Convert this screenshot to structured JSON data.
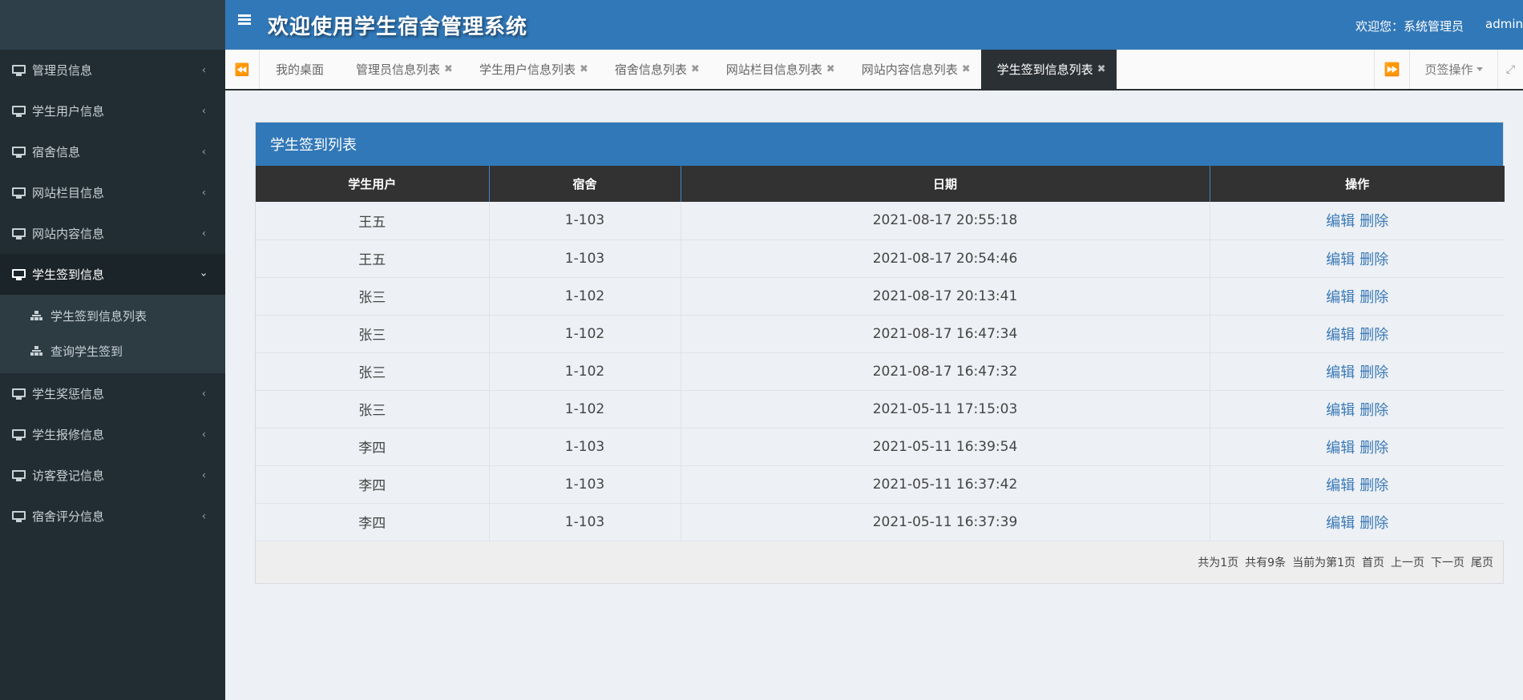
{
  "header": {
    "title": "欢迎使用学生宿舍管理系统",
    "welcome": "欢迎您：系统管理员",
    "user": "admin"
  },
  "sidebar": {
    "items": [
      {
        "label": "管理员信息"
      },
      {
        "label": "学生用户信息"
      },
      {
        "label": "宿舍信息"
      },
      {
        "label": "网站栏目信息"
      },
      {
        "label": "网站内容信息"
      },
      {
        "label": "学生签到信息"
      },
      {
        "label": "学生奖惩信息"
      },
      {
        "label": "学生报修信息"
      },
      {
        "label": "访客登记信息"
      },
      {
        "label": "宿舍评分信息"
      }
    ],
    "sub_items": [
      {
        "label": "学生签到信息列表"
      },
      {
        "label": "查询学生签到"
      }
    ]
  },
  "tabs": {
    "items": [
      {
        "label": "我的桌面"
      },
      {
        "label": "管理员信息列表"
      },
      {
        "label": "学生用户信息列表"
      },
      {
        "label": "宿舍信息列表"
      },
      {
        "label": "网站栏目信息列表"
      },
      {
        "label": "网站内容信息列表"
      },
      {
        "label": "学生签到信息列表"
      }
    ],
    "close_glyph": "✖",
    "page_ops": "页签操作"
  },
  "panel": {
    "title": "学生签到列表",
    "columns": [
      "学生用户",
      "宿舍",
      "日期",
      "操作"
    ],
    "rows": [
      {
        "user": "王五",
        "dorm": "1-103",
        "date": "2021-08-17 20:55:18"
      },
      {
        "user": "王五",
        "dorm": "1-103",
        "date": "2021-08-17 20:54:46"
      },
      {
        "user": "张三",
        "dorm": "1-102",
        "date": "2021-08-17 20:13:41"
      },
      {
        "user": "张三",
        "dorm": "1-102",
        "date": "2021-08-17 16:47:34"
      },
      {
        "user": "张三",
        "dorm": "1-102",
        "date": "2021-08-17 16:47:32"
      },
      {
        "user": "张三",
        "dorm": "1-102",
        "date": "2021-05-11 17:15:03"
      },
      {
        "user": "李四",
        "dorm": "1-103",
        "date": "2021-05-11 16:39:54"
      },
      {
        "user": "李四",
        "dorm": "1-103",
        "date": "2021-05-11 16:37:42"
      },
      {
        "user": "李四",
        "dorm": "1-103",
        "date": "2021-05-11 16:37:39"
      }
    ],
    "edit_label": "编辑",
    "delete_label": "删除",
    "pager": {
      "total_pages": "共为1页",
      "total_records": "共有9条",
      "current": "当前为第1页",
      "first": "首页",
      "prev": "上一页",
      "next": "下一页",
      "last": "尾页"
    }
  }
}
